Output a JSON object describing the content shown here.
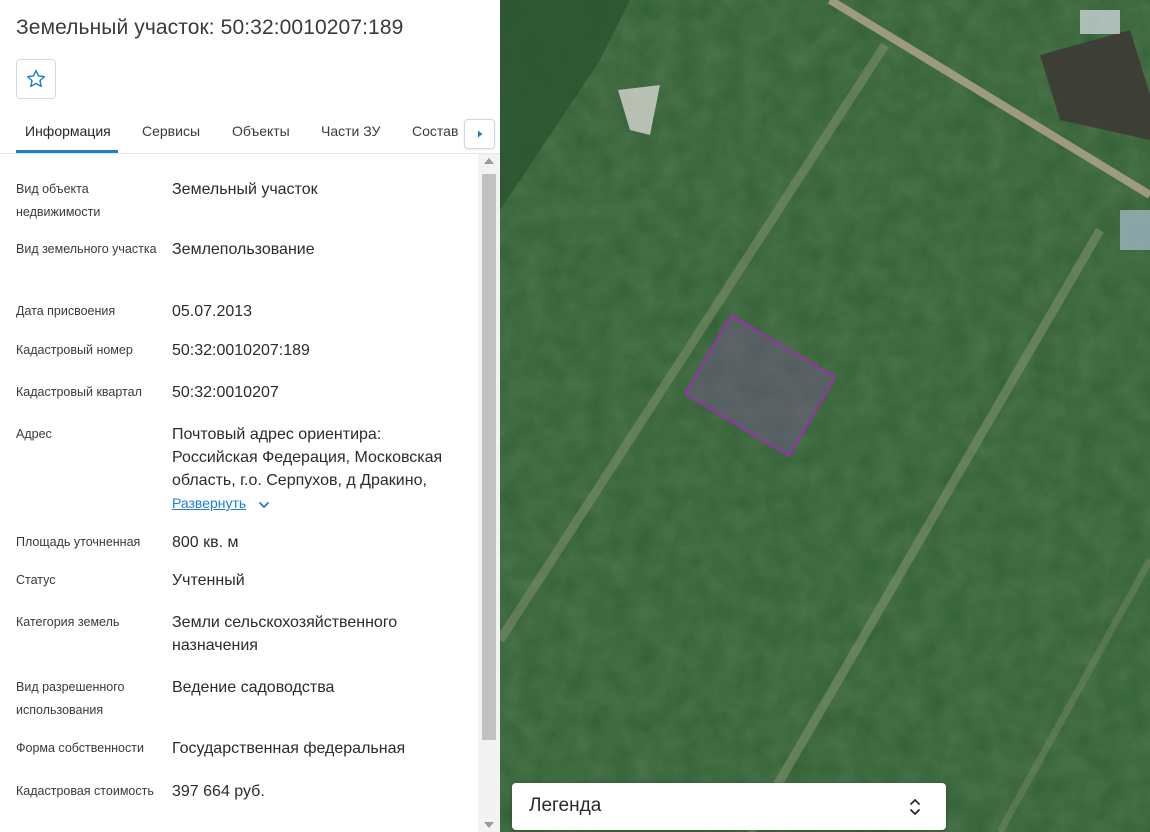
{
  "header": {
    "title": "Земельный участок: 50:32:0010207:189"
  },
  "toolbar": {
    "favorite_icon": "star-outline-icon"
  },
  "tabs": [
    {
      "label": "Информация",
      "active": true
    },
    {
      "label": "Сервисы",
      "active": false
    },
    {
      "label": "Объекты",
      "active": false
    },
    {
      "label": "Части ЗУ",
      "active": false
    },
    {
      "label": "Состав",
      "active": false
    }
  ],
  "tab_scroll_icon": "caret-right-icon",
  "info": {
    "rows": [
      {
        "label": "Вид объекта недвижимости",
        "value": "Земельный участок"
      },
      {
        "label": "Вид земельного участка",
        "value": "Землепользование"
      },
      {
        "label": "Дата присвоения",
        "value": "05.07.2013"
      },
      {
        "label": "Кадастровый номер",
        "value": "50:32:0010207:189"
      },
      {
        "label": "Кадастровый квартал",
        "value": "50:32:0010207"
      },
      {
        "label": "Адрес",
        "value": "Почтовый адрес ориентира: Российская Федерация, Московская область, г.о. Серпухов, д Дракино,"
      },
      {
        "label": "Площадь уточненная",
        "value": "800 кв. м"
      },
      {
        "label": "Статус",
        "value": "Учтенный"
      },
      {
        "label": "Категория земель",
        "value": "Земли сельскохозяйственного назначения"
      },
      {
        "label": "Вид разрешенного использования",
        "value": "Ведение садоводства"
      },
      {
        "label": "Форма собственности",
        "value": "Государственная федеральная"
      },
      {
        "label": "Кадастровая стоимость",
        "value": "397 664 руб."
      }
    ],
    "expand_label": "Развернуть",
    "expand_icon": "chevron-down-icon"
  },
  "map": {
    "parcel_outline_color": "#9b2fae",
    "legend_label": "Легенда",
    "legend_icon": "sort-arrows-icon"
  },
  "colors": {
    "accent": "#1e7fd1"
  }
}
